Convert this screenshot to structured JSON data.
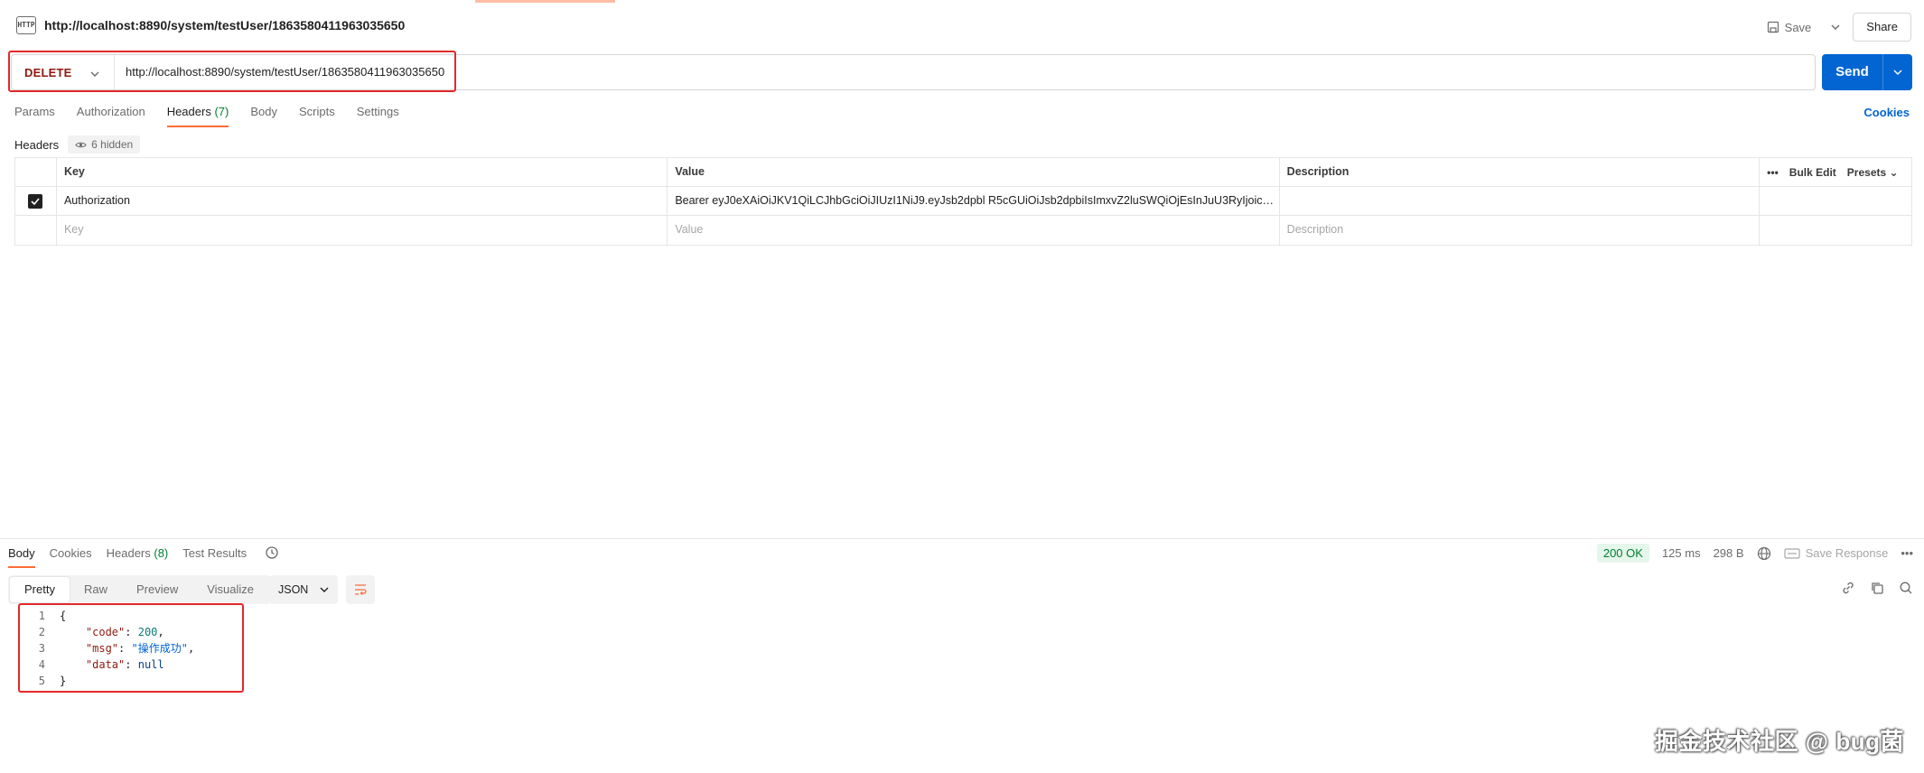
{
  "request": {
    "title": "http://localhost:8890/system/testUser/1863580411963035650",
    "method": "DELETE",
    "url": "http://localhost:8890/system/testUser/1863580411963035650",
    "save_label": "Save",
    "share_label": "Share",
    "send_label": "Send"
  },
  "request_tabs": {
    "params": "Params",
    "authorization": "Authorization",
    "headers": "Headers",
    "headers_count": "(7)",
    "body": "Body",
    "scripts": "Scripts",
    "settings": "Settings",
    "cookies": "Cookies"
  },
  "headers_section": {
    "label": "Headers",
    "hidden": "6 hidden",
    "columns": {
      "key": "Key",
      "value": "Value",
      "description": "Description"
    },
    "bulk_edit": "Bulk Edit",
    "presets": "Presets",
    "rows": [
      {
        "checked": true,
        "key": "Authorization",
        "value": "Bearer eyJ0eXAiOiJKV1QiLCJhbGciOiJIUzI1NiJ9.eyJsb2dpbl R5cGUiOiJsb2dpbiIsImxvZ2luSWQiOjEsInJuU3RyIjoicm...",
        "description": ""
      }
    ],
    "placeholders": {
      "key": "Key",
      "value": "Value",
      "description": "Description"
    }
  },
  "response_tabs": {
    "body": "Body",
    "cookies": "Cookies",
    "headers": "Headers",
    "headers_count": "(8)",
    "test_results": "Test Results"
  },
  "response_meta": {
    "status": "200 OK",
    "time": "125 ms",
    "size": "298 B",
    "save_response": "Save Response"
  },
  "response_view": {
    "modes": [
      "Pretty",
      "Raw",
      "Preview",
      "Visualize"
    ],
    "active_mode": "Pretty",
    "format": "JSON"
  },
  "response_body": {
    "line_numbers": [
      "1",
      "2",
      "3",
      "4",
      "5"
    ],
    "open_brace": "{",
    "close_brace": "}",
    "code_key": "\"code\"",
    "code_value": "200",
    "msg_key": "\"msg\"",
    "msg_value": "\"操作成功\"",
    "data_key": "\"data\"",
    "data_value": "null"
  },
  "watermark": "掘金技术社区 @ bug菌",
  "colors": {
    "accent": "#ff6c37",
    "send_button": "#0265d2",
    "method_delete": "#8e1a10",
    "status_ok": "#007f31",
    "annotation_box": "#e5282a"
  }
}
